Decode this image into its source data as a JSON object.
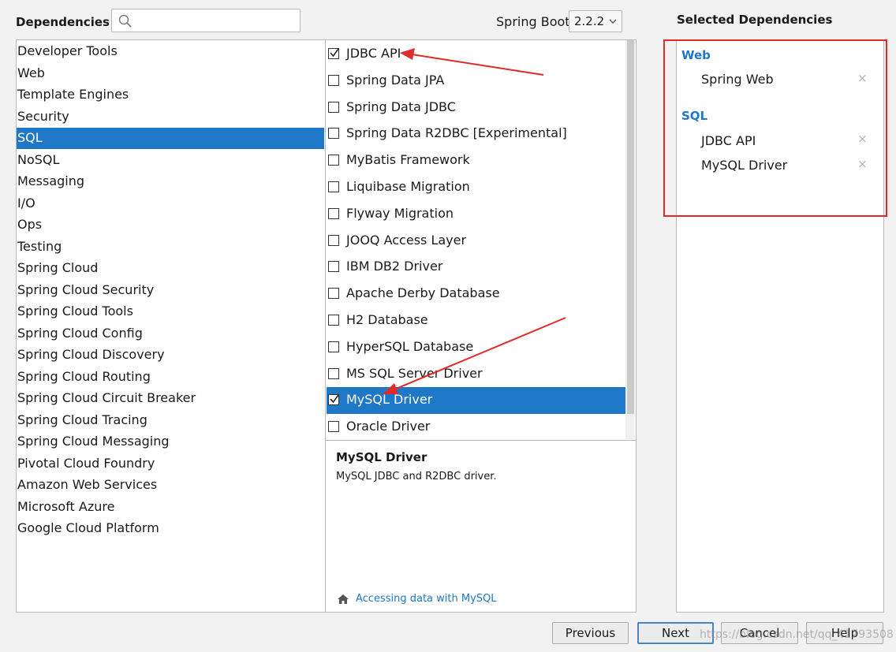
{
  "header": {
    "dependencies_title": "Dependencies",
    "search_placeholder": "",
    "spring_boot_label": "Spring Boot",
    "spring_boot_version": "2.2.2"
  },
  "categories": [
    "Developer Tools",
    "Web",
    "Template Engines",
    "Security",
    "SQL",
    "NoSQL",
    "Messaging",
    "I/O",
    "Ops",
    "Testing",
    "Spring Cloud",
    "Spring Cloud Security",
    "Spring Cloud Tools",
    "Spring Cloud Config",
    "Spring Cloud Discovery",
    "Spring Cloud Routing",
    "Spring Cloud Circuit Breaker",
    "Spring Cloud Tracing",
    "Spring Cloud Messaging",
    "Pivotal Cloud Foundry",
    "Amazon Web Services",
    "Microsoft Azure",
    "Google Cloud Platform"
  ],
  "selected_category": "SQL",
  "dependencies": [
    {
      "label": "JDBC API",
      "checked": true
    },
    {
      "label": "Spring Data JPA",
      "checked": false
    },
    {
      "label": "Spring Data JDBC",
      "checked": false
    },
    {
      "label": "Spring Data R2DBC [Experimental]",
      "checked": false
    },
    {
      "label": "MyBatis Framework",
      "checked": false
    },
    {
      "label": "Liquibase Migration",
      "checked": false
    },
    {
      "label": "Flyway Migration",
      "checked": false
    },
    {
      "label": "JOOQ Access Layer",
      "checked": false
    },
    {
      "label": "IBM DB2 Driver",
      "checked": false
    },
    {
      "label": "Apache Derby Database",
      "checked": false
    },
    {
      "label": "H2 Database",
      "checked": false
    },
    {
      "label": "HyperSQL Database",
      "checked": false
    },
    {
      "label": "MS SQL Server Driver",
      "checked": false
    },
    {
      "label": "MySQL Driver",
      "checked": true,
      "selected": true
    },
    {
      "label": "Oracle Driver",
      "checked": false
    }
  ],
  "description": {
    "title": "MySQL Driver",
    "text": "MySQL JDBC and R2DBC driver.",
    "guide_link": "Accessing data with MySQL"
  },
  "selected_panel": {
    "title": "Selected Dependencies",
    "groups": [
      {
        "name": "Web",
        "items": [
          "Spring Web"
        ]
      },
      {
        "name": "SQL",
        "items": [
          "JDBC API",
          "MySQL Driver"
        ]
      }
    ],
    "remove_glyph": "×"
  },
  "footer": {
    "previous": "Previous",
    "next": "Next",
    "cancel": "Cancel",
    "help": "Help"
  },
  "watermark": "https://blog.csdn.net/qq_41793508",
  "colors": {
    "selection": "#1f77c8",
    "link": "#1f77c8",
    "annotation": "#e02b2b"
  }
}
